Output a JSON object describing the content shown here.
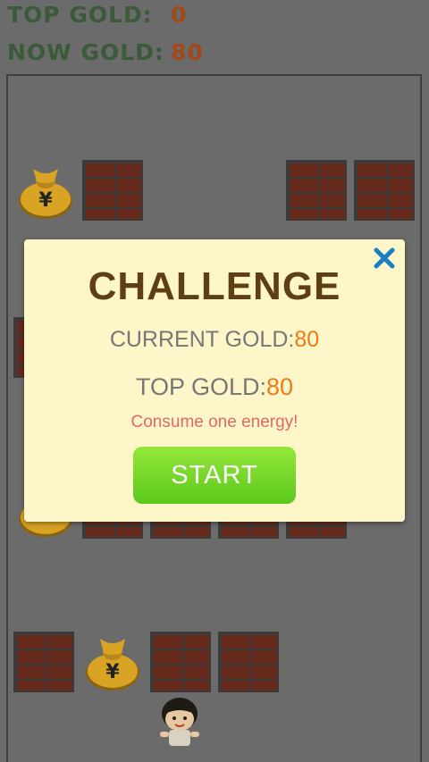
{
  "hud": {
    "top_gold_label": "TOP GOLD:",
    "top_gold_value": "0",
    "now_gold_label": "NOW GOLD:",
    "now_gold_value": "80"
  },
  "dialog": {
    "title": "CHALLENGE",
    "current_gold_label": "CURRENT GOLD:",
    "current_gold_value": "80",
    "top_gold_label": "TOP GOLD:",
    "top_gold_value": "80",
    "energy_note": "Consume one energy!",
    "start_label": "START",
    "close_icon": "close-icon"
  },
  "colors": {
    "background_dim": "#6b6b6b",
    "dialog_bg": "#fdf6c8",
    "title": "#5e3f13",
    "gold_value": "#ee7b17",
    "start_button": "#7bd82a",
    "close_icon": "#1b7fc4"
  },
  "board": {
    "icons": [
      "brick-tile",
      "money-bag-icon",
      "player-character"
    ]
  }
}
